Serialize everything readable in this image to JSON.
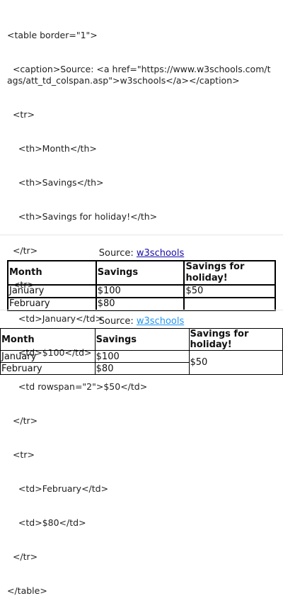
{
  "code": {
    "lines": [
      "<table border=\"1\">",
      "  <caption>Source: <a href=\"https://www.w3schools.com/tags/att_td_colspan.asp\">w3schools</a></caption>",
      "  <tr>",
      "    <th>Month</th>",
      "    <th>Savings</th>",
      "    <th>Savings for holiday!</th>",
      "  </tr>",
      "  <tr>",
      "    <td>January</td>",
      "    <td>$100</td>",
      "    <td rowspan=\"2\">$50</td>",
      "  </tr>",
      "  <tr>",
      "    <td>February</td>",
      "    <td>$80</td>",
      "  </tr>",
      "</table>"
    ]
  },
  "table": {
    "caption_prefix": "Source: ",
    "caption_link": "w3schools",
    "headers": [
      "Month",
      "Savings",
      "Savings for holiday!"
    ],
    "rows": [
      [
        "January",
        "$100",
        "$50"
      ],
      [
        "February",
        "$80"
      ]
    ]
  },
  "colors": {
    "link_rendered_1": "#1a0dab",
    "link_rendered_2": "#2196f3",
    "divider": "#e6e6e6"
  }
}
